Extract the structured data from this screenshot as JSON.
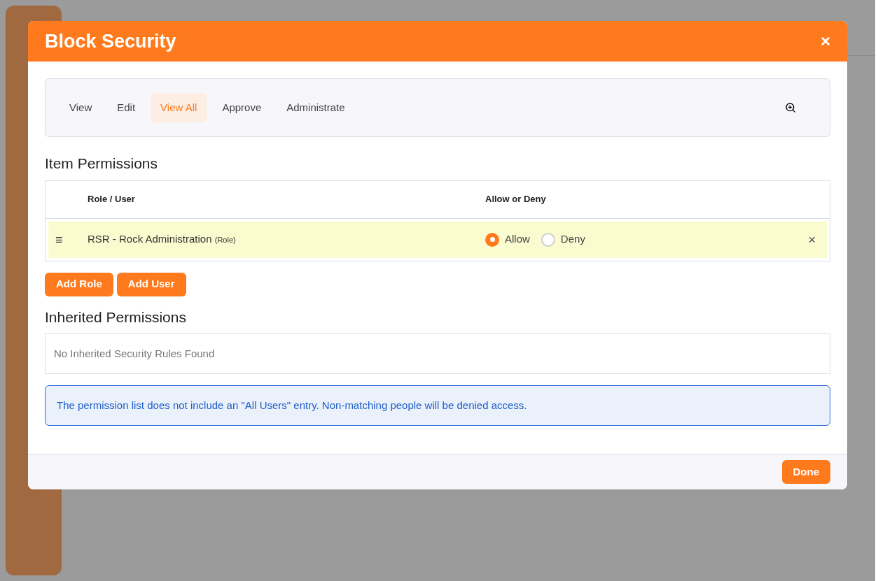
{
  "modal": {
    "title": "Block Security",
    "close": "×",
    "tabs": [
      {
        "label": "View",
        "selected": false
      },
      {
        "label": "Edit",
        "selected": false
      },
      {
        "label": "View All",
        "selected": true
      },
      {
        "label": "Approve",
        "selected": false
      },
      {
        "label": "Administrate",
        "selected": false
      }
    ],
    "item_permissions": {
      "heading": "Item Permissions",
      "columns": [
        "Role / User",
        "Allow or Deny"
      ],
      "rows": [
        {
          "handle": "≡",
          "name": "RSR - Rock Administration",
          "type": "(Role)",
          "options": [
            {
              "label": "Allow",
              "selected": true
            },
            {
              "label": "Deny",
              "selected": false
            }
          ],
          "remove": "×"
        }
      ]
    },
    "buttons": [
      "Add Role",
      "Add User"
    ],
    "inherited": {
      "heading": "Inherited Permissions",
      "empty": "No Inherited Security Rules Found"
    },
    "alert": "The permission list does not include an \"All Users\" entry. Non-matching people will be denied access.",
    "footer_button": "Done"
  }
}
